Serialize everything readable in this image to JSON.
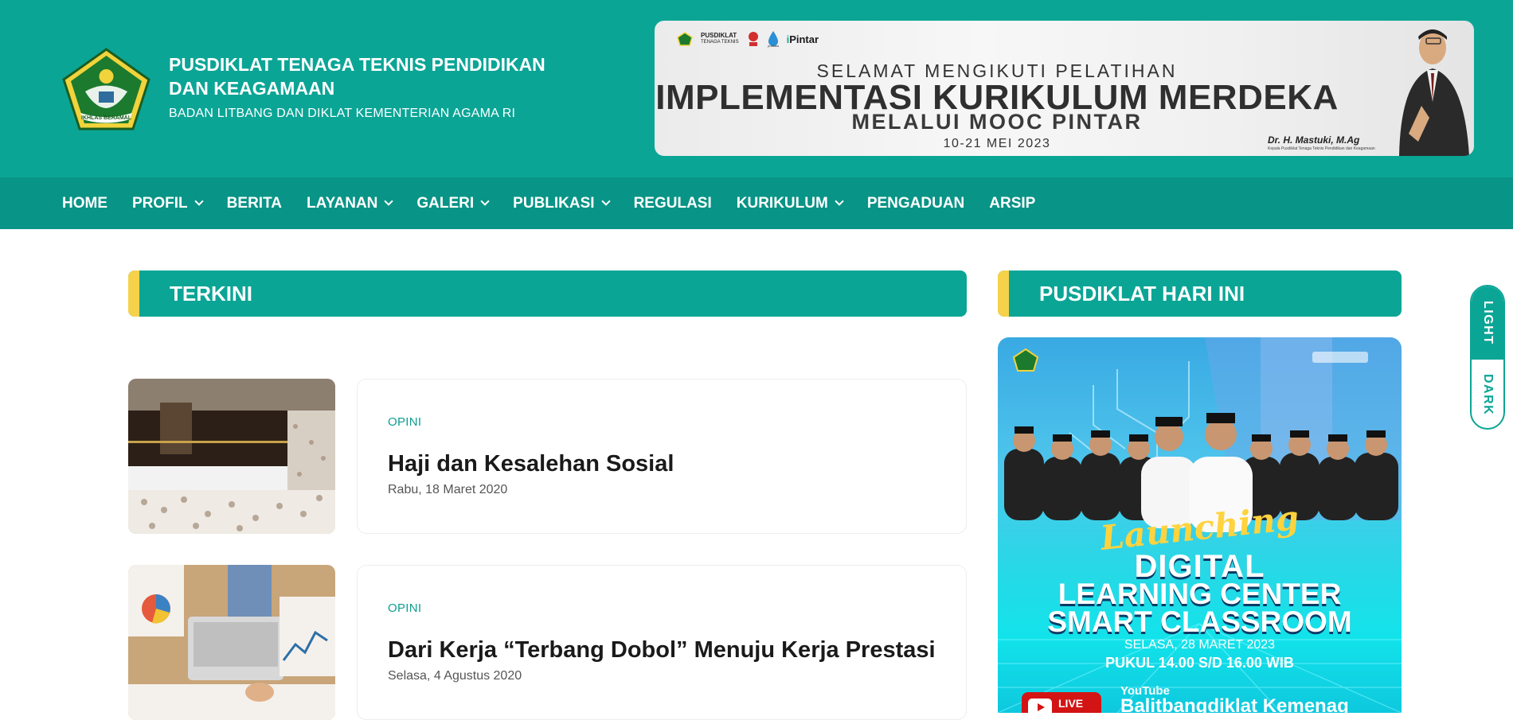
{
  "header": {
    "title": "PUSDIKLAT TENAGA TEKNIS PENDIDIKAN DAN KEAGAMAAN",
    "subtitle": "BADAN LITBANG DAN DIKLAT KEMENTERIAN AGAMA RI",
    "logo_text": "IKHLAS BERAMAL"
  },
  "banner": {
    "logo_pusdiklat": "PUSDIKLAT",
    "logo_pusdiklat_sub": "TENAGA TEKNIS",
    "logo_pustaka": "pustaka",
    "logo_pintar": "Pintar",
    "line1": "SELAMAT MENGIKUTI PELATIHAN",
    "line2": "IMPLEMENTASI KURIKULUM MERDEKA",
    "line3": "MELALUI MOOC PINTAR",
    "line4": "10-21 MEI 2023",
    "person_name": "Dr. H. Mastuki, M.Ag",
    "person_role": "Kepala Pusdiklat Tenaga Teknis Pendidikan dan Keagamaan"
  },
  "nav": {
    "items": [
      {
        "label": "HOME",
        "dropdown": false
      },
      {
        "label": "PROFIL",
        "dropdown": true
      },
      {
        "label": "BERITA",
        "dropdown": false
      },
      {
        "label": "LAYANAN",
        "dropdown": true
      },
      {
        "label": "GALERI",
        "dropdown": true
      },
      {
        "label": "PUBLIKASI",
        "dropdown": true
      },
      {
        "label": "REGULASI",
        "dropdown": false
      },
      {
        "label": "KURIKULUM",
        "dropdown": true
      },
      {
        "label": "PENGADUAN",
        "dropdown": false
      },
      {
        "label": "ARSIP",
        "dropdown": false
      }
    ]
  },
  "sections": {
    "terkini": "TERKINI",
    "hari_ini": "PUSDIKLAT HARI INI"
  },
  "articles": [
    {
      "category": "OPINI",
      "title": "Haji dan Kesalehan Sosial",
      "date": "Rabu, 18 Maret 2020"
    },
    {
      "category": "OPINI",
      "title": "Dari Kerja “Terbang Dobol” Menuju Kerja Prestasi",
      "date": "Selasa, 4 Agustus 2020"
    }
  ],
  "poster": {
    "launching": "Launching",
    "line1": "DIGITAL",
    "line2": "LEARNING CENTER",
    "line3": "SMART CLASSROOM",
    "date": "SELASA, 28 MARET 2023",
    "time": "PUKUL 14.00 S/D 16.00 WIB",
    "live": "LIVE",
    "platform": "YouTube",
    "channel": "Balitbangdiklat Kemenag"
  },
  "theme_toggle": {
    "light": "LIGHT",
    "dark": "DARK"
  },
  "colors": {
    "primary": "#0ba596",
    "nav": "#089486",
    "accent": "#f5d24a",
    "category": "#0f9d91"
  }
}
